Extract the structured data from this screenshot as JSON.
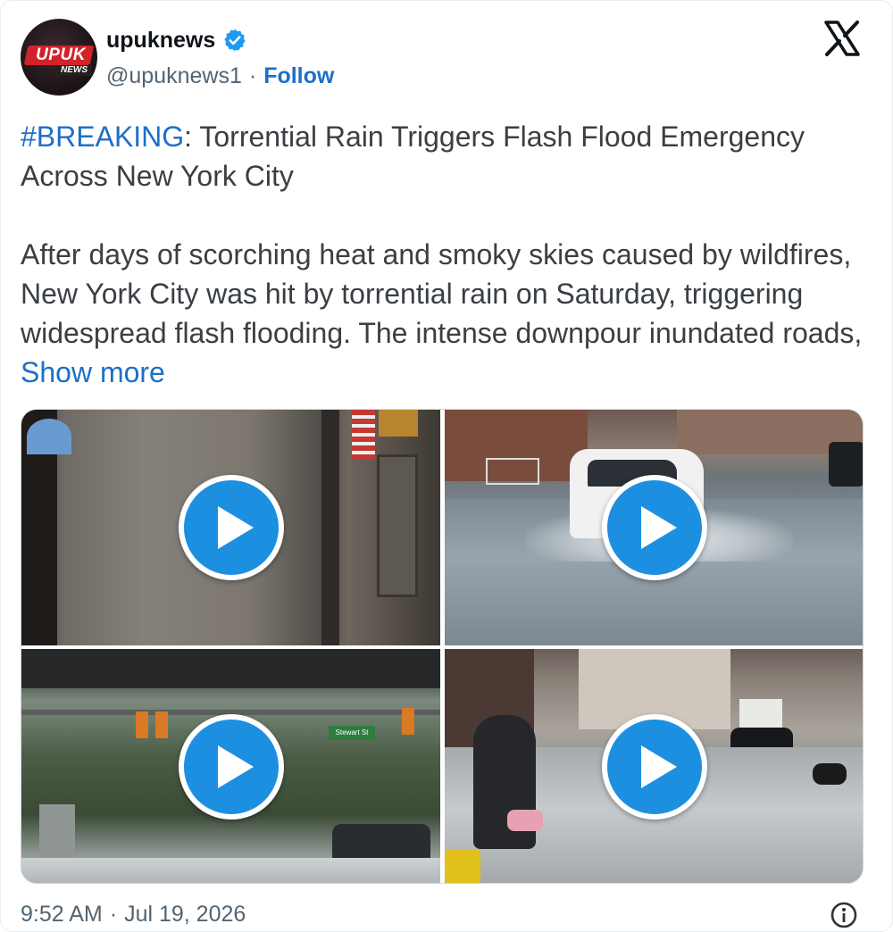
{
  "account": {
    "display_name": "upuknews",
    "handle": "@upuknews1",
    "separator": "·",
    "follow_label": "Follow",
    "avatar_logo_text": "UPUK",
    "avatar_logo_sub": "NEWS",
    "verified_color": "#1d9bf0"
  },
  "tweet": {
    "hashtag": "#BREAKING",
    "headline_rest": ": Torrential Rain Triggers Flash Flood Emergency Across New York City",
    "body": "After days of scorching heat and smoky skies caused by wildfires, New York City was hit by torrential rain on Saturday, triggering widespread flash flooding. The intense downpour inundated roads,",
    "show_more_label": "Show more"
  },
  "media": {
    "tiles": [
      {
        "icon": "play-icon"
      },
      {
        "icon": "play-icon"
      },
      {
        "icon": "play-icon"
      },
      {
        "icon": "play-icon"
      }
    ],
    "play_color": "#1d8fe0",
    "street_sign": "Stewart St"
  },
  "footer": {
    "time": "9:52 AM",
    "separator": "·",
    "date": "Jul 19, 2026",
    "info_icon": "info-icon"
  },
  "colors": {
    "link": "#1d6fc8",
    "text": "#3a3f44",
    "muted": "#536471"
  }
}
